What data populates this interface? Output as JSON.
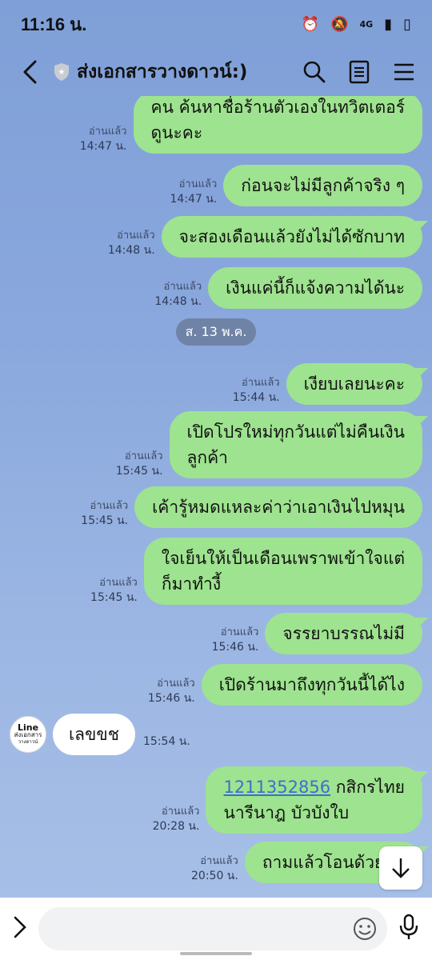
{
  "status": {
    "time": "11:16 น.",
    "network": "4G"
  },
  "header": {
    "title": "ส่งเอกสารวางดาวน์:)"
  },
  "messages": [
    {
      "read": "อ่านแล้ว",
      "time": "14:47 น.",
      "lines": [
        "คน ค้นหาชื่อร้านตัวเองในทวิตเตอร์",
        "ดูนะคะ"
      ]
    },
    {
      "read": "อ่านแล้ว",
      "time": "14:47 น.",
      "lines": [
        "ก่อนจะไม่มีลูกค้าจริง ๆ"
      ]
    },
    {
      "read": "อ่านแล้ว",
      "time": "14:48 น.",
      "lines": [
        "จะสองเดือนแล้วยังไม่ได้ซักบาท"
      ]
    },
    {
      "read": "อ่านแล้ว",
      "time": "14:48 น.",
      "lines": [
        "เงินแค่นี้ก็แจ้งความได้นะ"
      ]
    },
    {
      "read": "อ่านแล้ว",
      "time": "15:44 น.",
      "lines": [
        "เงียบเลยนะคะ"
      ]
    },
    {
      "read": "อ่านแล้ว",
      "time": "15:45 น.",
      "lines": [
        "เปิดโปรใหม่ทุกวันแต่ไม่คืนเงิน",
        "ลูกค้า"
      ]
    },
    {
      "read": "อ่านแล้ว",
      "time": "15:45 น.",
      "lines": [
        "เค้ารู้หมดแหละค่าว่าเอาเงินไปหมุน"
      ]
    },
    {
      "read": "อ่านแล้ว",
      "time": "15:45 น.",
      "lines": [
        "ใจเย็นให้เป็นเดือนเพราพเข้าใจแต่",
        "ก็มาทำงี้"
      ]
    },
    {
      "read": "อ่านแล้ว",
      "time": "15:46 น.",
      "lines": [
        "จรรยาบรรณไม่มี"
      ]
    },
    {
      "read": "อ่านแล้ว",
      "time": "15:46 น.",
      "lines": [
        "เปิดร้านมาถึงทุกวันนี้ได้ไง"
      ]
    },
    {
      "read": "อ่านแล้ว",
      "time": "20:28 น.",
      "link": "1211352856",
      "lines": [
        " กสิกรไทย",
        "นารีนาฎ บัวบังใบ"
      ]
    },
    {
      "read": "อ่านแล้ว",
      "time": "20:50 น.",
      "lines": [
        "ถามแล้วโอนด้วยนะ"
      ]
    }
  ],
  "date_chip": "ส. 13 พ.ค.",
  "incoming": {
    "avatar_title": "Line",
    "avatar_sub": "ส่งเอกสาร",
    "avatar_sub2": "วางดาวน์",
    "text": "เลขขช",
    "time": "15:54 น."
  }
}
